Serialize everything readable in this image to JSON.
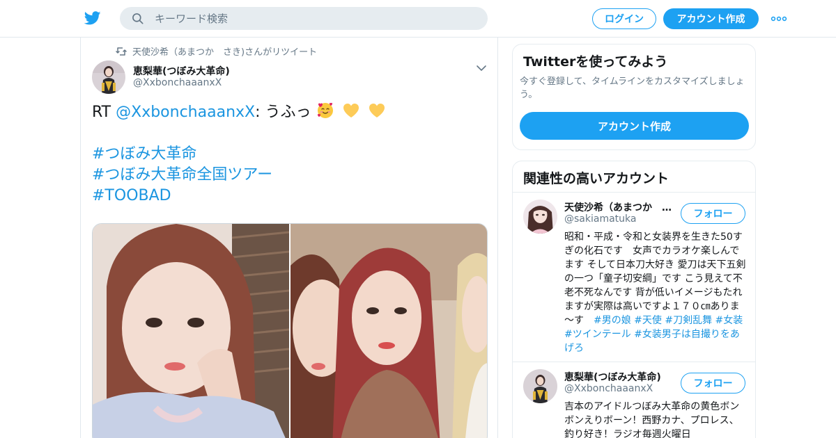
{
  "header": {
    "search_placeholder": "キーワード検索",
    "login_label": "ログイン",
    "signup_label": "アカウント作成"
  },
  "tweet": {
    "retweet_context": "天使沙希（あまつか　さき)さんがリツイート",
    "author_name": "恵梨華(つぼみ大革命)",
    "author_handle": "@XxbonchaaanxX",
    "text_prefix": "RT ",
    "mention": "@XxbonchaaanxX",
    "text_body": ": うふっ",
    "hashtags": [
      "#つぼみ大革命",
      "#つぼみ大革命全国ツアー",
      "#TOOBAD"
    ]
  },
  "sidebar": {
    "signup_card": {
      "title": "Twitterを使ってみよう",
      "description": "今すぐ登録して、タイムラインをカスタマイズしましょう。",
      "button_label": "アカウント作成"
    },
    "related": {
      "title": "関連性の高いアカウント",
      "follow_label": "フォロー",
      "accounts": [
        {
          "name": "天使沙希（あまつか　さき)",
          "handle": "@sakiamatuka",
          "bio": "昭和・平成・令和と女装界を生きた50すぎの化石です　女声でカラオケ楽しんでます そして日本刀大好き 愛刀は天下五剣の一つ「童子切安綱」です こう見えて不老不死なんです 背が低いイメージもたれますが実際は高いですよ１７０㎝ありま～す　",
          "bio_tags": "#男の娘 #天使 #刀剣乱舞 #女装 #ツインテール #女装男子は自撮りをあげろ"
        },
        {
          "name": "恵梨華(つぼみ大革命)",
          "handle": "@XxbonchaaanxX",
          "bio": "吉本のアイドルつぼみ大革命の黄色ボンボンえりボーン！西野カナ、プロレス、釣り好き！ラジオ毎週火曜日"
        }
      ]
    }
  }
}
